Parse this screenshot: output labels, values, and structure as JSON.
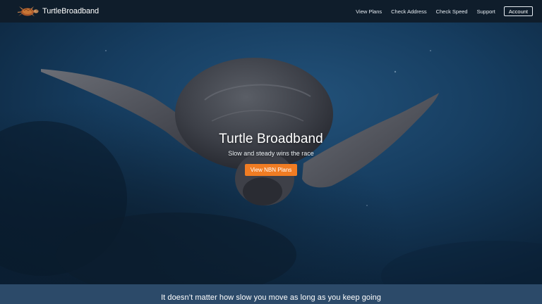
{
  "brand": {
    "name": "TurtleBroadband",
    "logo_icon": "turtle-logo-icon"
  },
  "nav": {
    "links": [
      "View Plans",
      "Check Address",
      "Check Speed",
      "Support"
    ],
    "account_label": "Account"
  },
  "hero": {
    "title": "Turtle Broadband",
    "subtitle": "Slow and steady wins the race",
    "cta_label": "View NBN Plans",
    "image": "sea-turtle-swimming-underwater"
  },
  "tagline": {
    "text": "It doesn’t matter how slow you move as long as you keep going"
  },
  "colors": {
    "navbar": "#0f1d2b",
    "hero_water": "#143a5c",
    "cta": "#f07c23",
    "tagline_strip": "#2c4a69",
    "text": "#ffffff"
  }
}
